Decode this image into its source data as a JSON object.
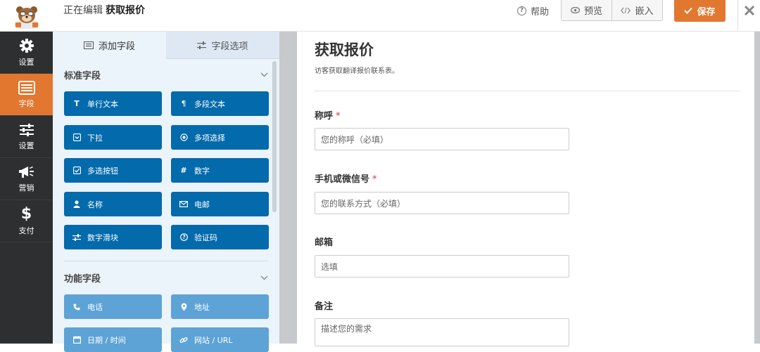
{
  "header": {
    "editing_label": "正在编辑",
    "form_name": "获取报价",
    "help_label": "帮助",
    "preview_label": "预览",
    "embed_label": "嵌入",
    "save_label": "保存",
    "accent_color": "#e27730"
  },
  "rail": {
    "items": [
      {
        "label": "设置",
        "icon": "gear-icon"
      },
      {
        "label": "字段",
        "icon": "fields-list-icon",
        "active": true
      },
      {
        "label": "设置",
        "icon": "sliders-icon"
      },
      {
        "label": "营销",
        "icon": "megaphone-icon"
      },
      {
        "label": "支付",
        "icon": "dollar-icon"
      }
    ]
  },
  "panel": {
    "tabs": [
      {
        "label": "添加字段",
        "icon": "list-icon",
        "active": true
      },
      {
        "label": "字段选项",
        "icon": "sliders-icon",
        "active": false
      }
    ],
    "standard": {
      "title": "标准字段",
      "fields": [
        {
          "label": "单行文本",
          "icon": "text-icon"
        },
        {
          "label": "多段文本",
          "icon": "paragraph-icon"
        },
        {
          "label": "下拉",
          "icon": "dropdown-icon"
        },
        {
          "label": "多项选择",
          "icon": "radio-icon"
        },
        {
          "label": "多选按钮",
          "icon": "checkbox-icon"
        },
        {
          "label": "数字",
          "icon": "hash-icon"
        },
        {
          "label": "名称",
          "icon": "user-icon"
        },
        {
          "label": "电邮",
          "icon": "envelope-icon"
        },
        {
          "label": "数字滑块",
          "icon": "slider-icon"
        },
        {
          "label": "验证码",
          "icon": "question-icon"
        }
      ]
    },
    "fancy": {
      "title": "功能字段",
      "fields": [
        {
          "label": "电话",
          "icon": "phone-icon"
        },
        {
          "label": "地址",
          "icon": "map-pin-icon"
        },
        {
          "label": "日期 / 时间",
          "icon": "calendar-icon"
        },
        {
          "label": "网站 / URL",
          "icon": "link-icon"
        }
      ]
    }
  },
  "form": {
    "title": "获取报价",
    "description": "访客获取翻译报价联系表。",
    "fields": [
      {
        "label": "称呼",
        "required": "*",
        "placeholder": "您的称呼（必填）"
      },
      {
        "label": "手机或微信号",
        "required": "*",
        "placeholder": "您的联系方式（必填）"
      },
      {
        "label": "邮箱",
        "required": "",
        "placeholder": "选填"
      },
      {
        "label": "备注",
        "required": "",
        "placeholder": "描述您的需求"
      }
    ]
  }
}
